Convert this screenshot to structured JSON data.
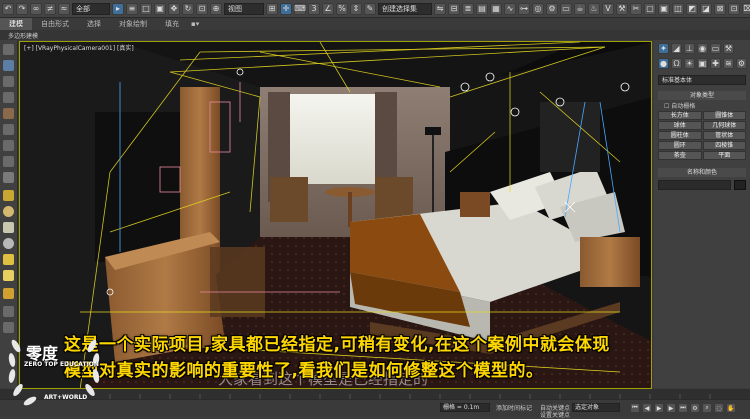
{
  "toolbar": {
    "undo_icon": "undo-icon",
    "filter_select": "全部",
    "view_select": "视图",
    "selection_set": "创建选择集"
  },
  "ribbon": {
    "tabs": [
      "建模",
      "自由形式",
      "选择",
      "对象绘制",
      "填充"
    ],
    "active": 0,
    "sub_label": "多边形建模"
  },
  "viewport": {
    "label": "[+] [VRayPhysicalCamera001] [真实]"
  },
  "command_panel": {
    "category_select": "标准基本体",
    "object_type_header": "对象类型",
    "autogrid_label": "自动栅格",
    "primitives": [
      "长方体",
      "圆锥体",
      "球体",
      "几何球体",
      "圆柱体",
      "管状体",
      "圆环",
      "四棱锥",
      "茶壶",
      "平面"
    ],
    "name_color_header": "名称和颜色"
  },
  "subtitles": {
    "line1": "这是一个实际项目,家具都已经指定,可稍有变化,在这个案例中就会体现",
    "line2": "模型对真实的影响的重要性了,看我们是如何修整这个模型的。",
    "faded": "大家看到这个模型是已经指定的"
  },
  "logo": {
    "brand": "零度",
    "english": "ZERO TOP EDUCATION",
    "partner": "ART+WORLD"
  },
  "status": {
    "grid_label": "栅格 = 0.1m",
    "autokey_label": "自动关键点",
    "selected_label": "选定对象",
    "add_time_tag": "添加时间标记",
    "set_key_label": "设置关键点"
  },
  "colors": {
    "subtitle": "#ffd700",
    "viewport_border": "#a0a000",
    "active_button": "#3d6f9a"
  }
}
